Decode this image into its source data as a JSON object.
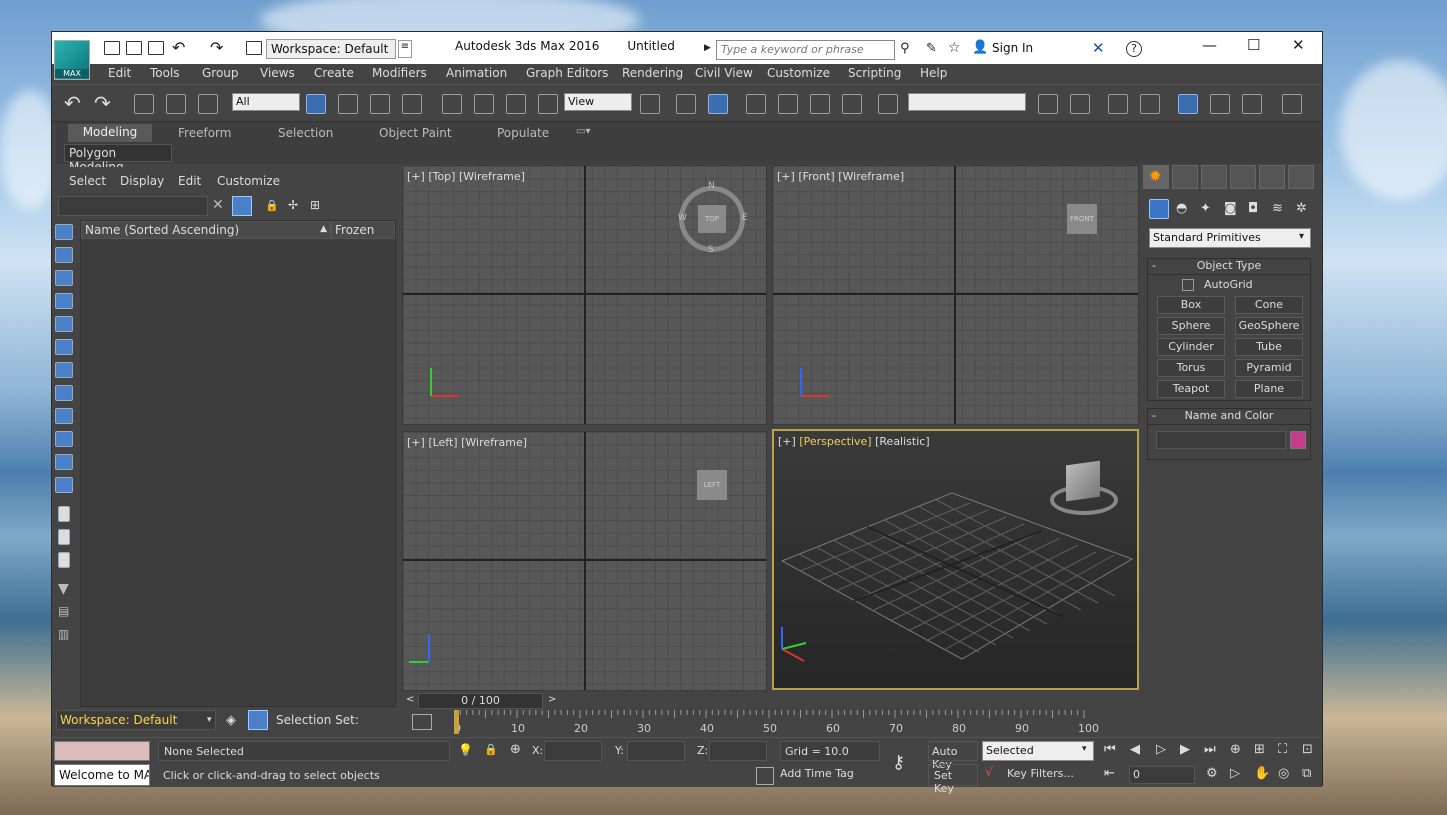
{
  "app": {
    "title": "Autodesk 3ds Max 2016",
    "document": "Untitled",
    "logo_label": "MAX"
  },
  "titlebar": {
    "workspace": "Workspace: Default",
    "search_placeholder": "Type a keyword or phrase",
    "sign_in": "Sign In"
  },
  "menu": [
    "Edit",
    "Tools",
    "Group",
    "Views",
    "Create",
    "Modifiers",
    "Animation",
    "Graph Editors",
    "Rendering",
    "Civil View",
    "Customize",
    "Scripting",
    "Help"
  ],
  "toolbar": {
    "selection_filter": "All",
    "ref_coord": "View"
  },
  "ribbon": {
    "tabs": [
      "Modeling",
      "Freeform",
      "Selection",
      "Object Paint",
      "Populate"
    ],
    "active": "Modeling",
    "panel": "Polygon Modeling"
  },
  "scene_explorer": {
    "menu": [
      "Select",
      "Display",
      "Edit",
      "Customize"
    ],
    "col_name": "Name (Sorted Ascending)",
    "col_frozen": "Frozen",
    "workspace": "Workspace: Default",
    "selection_set": "Selection Set:"
  },
  "viewports": {
    "top": {
      "plus": "[+]",
      "view": "[Top]",
      "mode": "[Wireframe]",
      "compass": {
        "n": "N",
        "s": "S",
        "e": "E",
        "w": "W",
        "cube": "TOP"
      }
    },
    "front": {
      "plus": "[+]",
      "view": "[Front]",
      "mode": "[Wireframe]",
      "cube": "FRONT"
    },
    "left": {
      "plus": "[+]",
      "view": "[Left]",
      "mode": "[Wireframe]",
      "cube": "LEFT"
    },
    "persp": {
      "plus": "[+]",
      "view": "[Perspective]",
      "mode": "[Realistic]"
    }
  },
  "timeline": {
    "frame": "0 / 100",
    "ticks": [
      "0",
      "10",
      "20",
      "30",
      "40",
      "50",
      "60",
      "70",
      "80",
      "90",
      "100"
    ]
  },
  "command_panel": {
    "category": "Standard Primitives",
    "object_type": "Object Type",
    "autogrid": "AutoGrid",
    "buttons": [
      "Box",
      "Cone",
      "Sphere",
      "GeoSphere",
      "Cylinder",
      "Tube",
      "Torus",
      "Pyramid",
      "Teapot",
      "Plane"
    ],
    "name_color": "Name and Color",
    "object_color": "#c43c8a"
  },
  "status": {
    "welcome": "Welcome to MAX",
    "selection": "None Selected",
    "hint": "Click or click-and-drag to select objects",
    "x": "X:",
    "y": "Y:",
    "z": "Z:",
    "grid": "Grid = 10.0",
    "add_time_tag": "Add Time Tag",
    "auto_key": "Auto Key",
    "set_key": "Set Key",
    "key_mode": "Selected",
    "key_filters": "Key Filters...",
    "frame": "0"
  }
}
